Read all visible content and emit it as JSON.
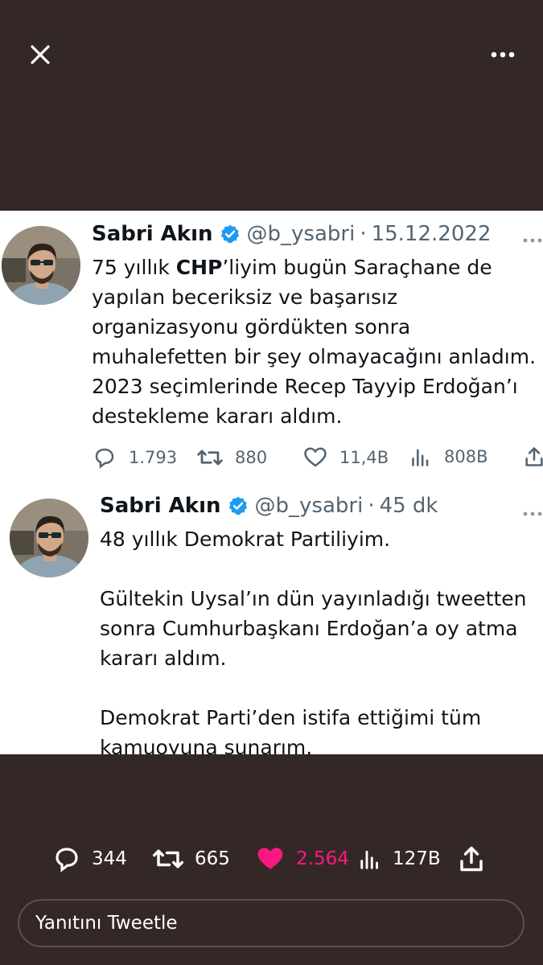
{
  "toolbar": {
    "close_icon": "close-icon",
    "more_icon": "more-icon"
  },
  "tweets": [
    {
      "name": "Sabri Akın",
      "handle": "@b_ysabri",
      "separator": "·",
      "time": "15.12.2022",
      "text_prefix": "75 yıllık ",
      "text_bold": "CHP",
      "text_suffix": "’liyim bugün Saraçhane de yapılan beceriksiz ve başarısız organizasyonu gördükten sonra muhalefetten bir şey olmayacağını anladım. 2023 seçimlerinde Recep Tayyip Erdoğan’ı destekleme kararı aldım.",
      "stats": {
        "replies": "1.793",
        "retweets": "880",
        "likes": "11,4B",
        "views": "808B"
      }
    },
    {
      "name": "Sabri Akın",
      "handle": "@b_ysabri",
      "separator": "·",
      "time": "45 dk",
      "paragraphs": [
        "48 yıllık Demokrat Partiliyim.",
        "Gültekin Uysal’ın dün yayınladığı tweetten sonra Cumhurbaşkanı Erdoğan’a oy atma kararı aldım.",
        "Demokrat Parti’den istifa ettiğimi tüm kamuoyuna sunarım."
      ]
    }
  ],
  "bottom_stats": {
    "replies": "344",
    "retweets": "665",
    "likes": "2.564",
    "views": "127B"
  },
  "reply": {
    "placeholder": "Yanıtını Tweetle"
  },
  "colors": {
    "background": "#342826",
    "verified": "#1d9bf0",
    "like": "#f91880",
    "muted": "#536471"
  }
}
